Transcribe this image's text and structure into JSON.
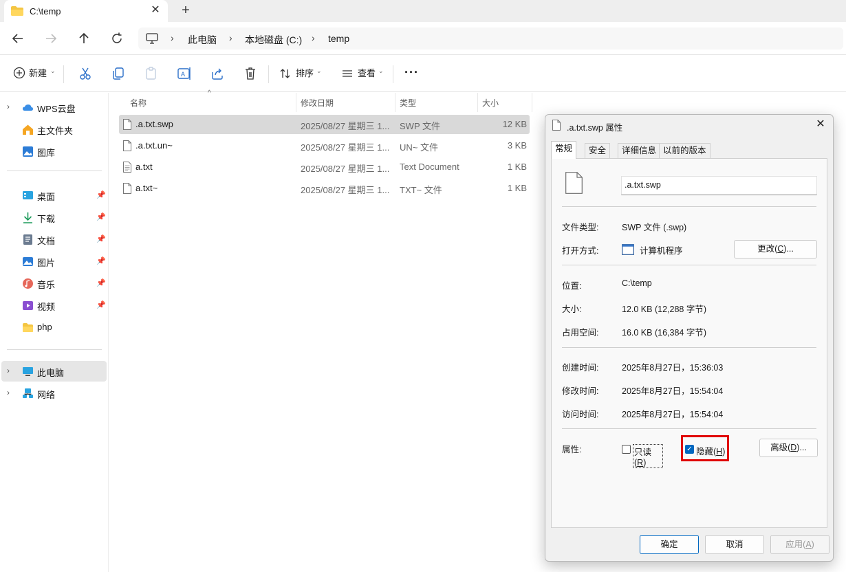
{
  "window": {
    "tab_title": "C:\\temp",
    "close_glyph": "✕",
    "new_tab_glyph": "+"
  },
  "breadcrumb": [
    "此电脑",
    "本地磁盘 (C:)",
    "temp"
  ],
  "toolbar": {
    "new_label": "新建",
    "sort_label": "排序",
    "view_label": "查看",
    "more_glyph": "···"
  },
  "sidebar": {
    "top_items": [
      {
        "label": "WPS云盘",
        "icon": "cloud-icon",
        "expandable": true
      },
      {
        "label": "主文件夹",
        "icon": "home-icon"
      },
      {
        "label": "图库",
        "icon": "gallery-icon"
      }
    ],
    "pinned_items": [
      {
        "label": "桌面",
        "icon": "desktop-icon"
      },
      {
        "label": "下载",
        "icon": "download-icon"
      },
      {
        "label": "文档",
        "icon": "document-icon"
      },
      {
        "label": "图片",
        "icon": "pictures-icon"
      },
      {
        "label": "音乐",
        "icon": "music-icon"
      },
      {
        "label": "视频",
        "icon": "video-icon"
      },
      {
        "label": "php",
        "icon": "folder-icon"
      }
    ],
    "bottom_items": [
      {
        "label": "此电脑",
        "icon": "computer-icon",
        "selected": true
      },
      {
        "label": "网络",
        "icon": "network-icon"
      }
    ]
  },
  "filelist": {
    "columns": [
      "名称",
      "修改日期",
      "类型",
      "大小"
    ],
    "rows": [
      {
        "name": ".a.txt.swp",
        "date": "2025/08/27 星期三 1...",
        "type": "SWP 文件",
        "size": "12 KB",
        "selected": true
      },
      {
        "name": ".a.txt.un~",
        "date": "2025/08/27 星期三 1...",
        "type": "UN~ 文件",
        "size": "3 KB"
      },
      {
        "name": "a.txt",
        "date": "2025/08/27 星期三 1...",
        "type": "Text Document",
        "size": "1 KB"
      },
      {
        "name": "a.txt~",
        "date": "2025/08/27 星期三 1...",
        "type": "TXT~ 文件",
        "size": "1 KB"
      }
    ]
  },
  "dialog": {
    "title": ".a.txt.swp 属性",
    "tabs": [
      "常规",
      "安全",
      "详细信息",
      "以前的版本"
    ],
    "file_name": ".a.txt.swp",
    "labels": {
      "file_type": "文件类型:",
      "open_with": "打开方式:",
      "location": "位置:",
      "size": "大小:",
      "size_on_disk": "占用空间:",
      "created": "创建时间:",
      "modified": "修改时间:",
      "accessed": "访问时间:",
      "attributes": "属性:"
    },
    "values": {
      "file_type": "SWP 文件 (.swp)",
      "open_with": "计算机程序",
      "location": "C:\\temp",
      "size": "12.0 KB (12,288 字节)",
      "size_on_disk": "16.0 KB (16,384 字节)",
      "created": "2025年8月27日，15:36:03",
      "modified": "2025年8月27日，15:54:04",
      "accessed": "2025年8月27日，15:54:04"
    },
    "change_button": {
      "text": "更改(",
      "key": "C",
      "suffix": ")..."
    },
    "advanced_button": {
      "text": "高级(",
      "key": "D",
      "suffix": ")..."
    },
    "readonly": {
      "text": "只读(",
      "key": "R",
      "suffix": ")",
      "checked": false
    },
    "hidden": {
      "text": "隐藏(",
      "key": "H",
      "suffix": ")",
      "checked": true
    },
    "ok_label": "确定",
    "cancel_label": "取消",
    "apply": {
      "text": "应用(",
      "key": "A",
      "suffix": ")"
    },
    "highlight_color": "#e00000"
  }
}
